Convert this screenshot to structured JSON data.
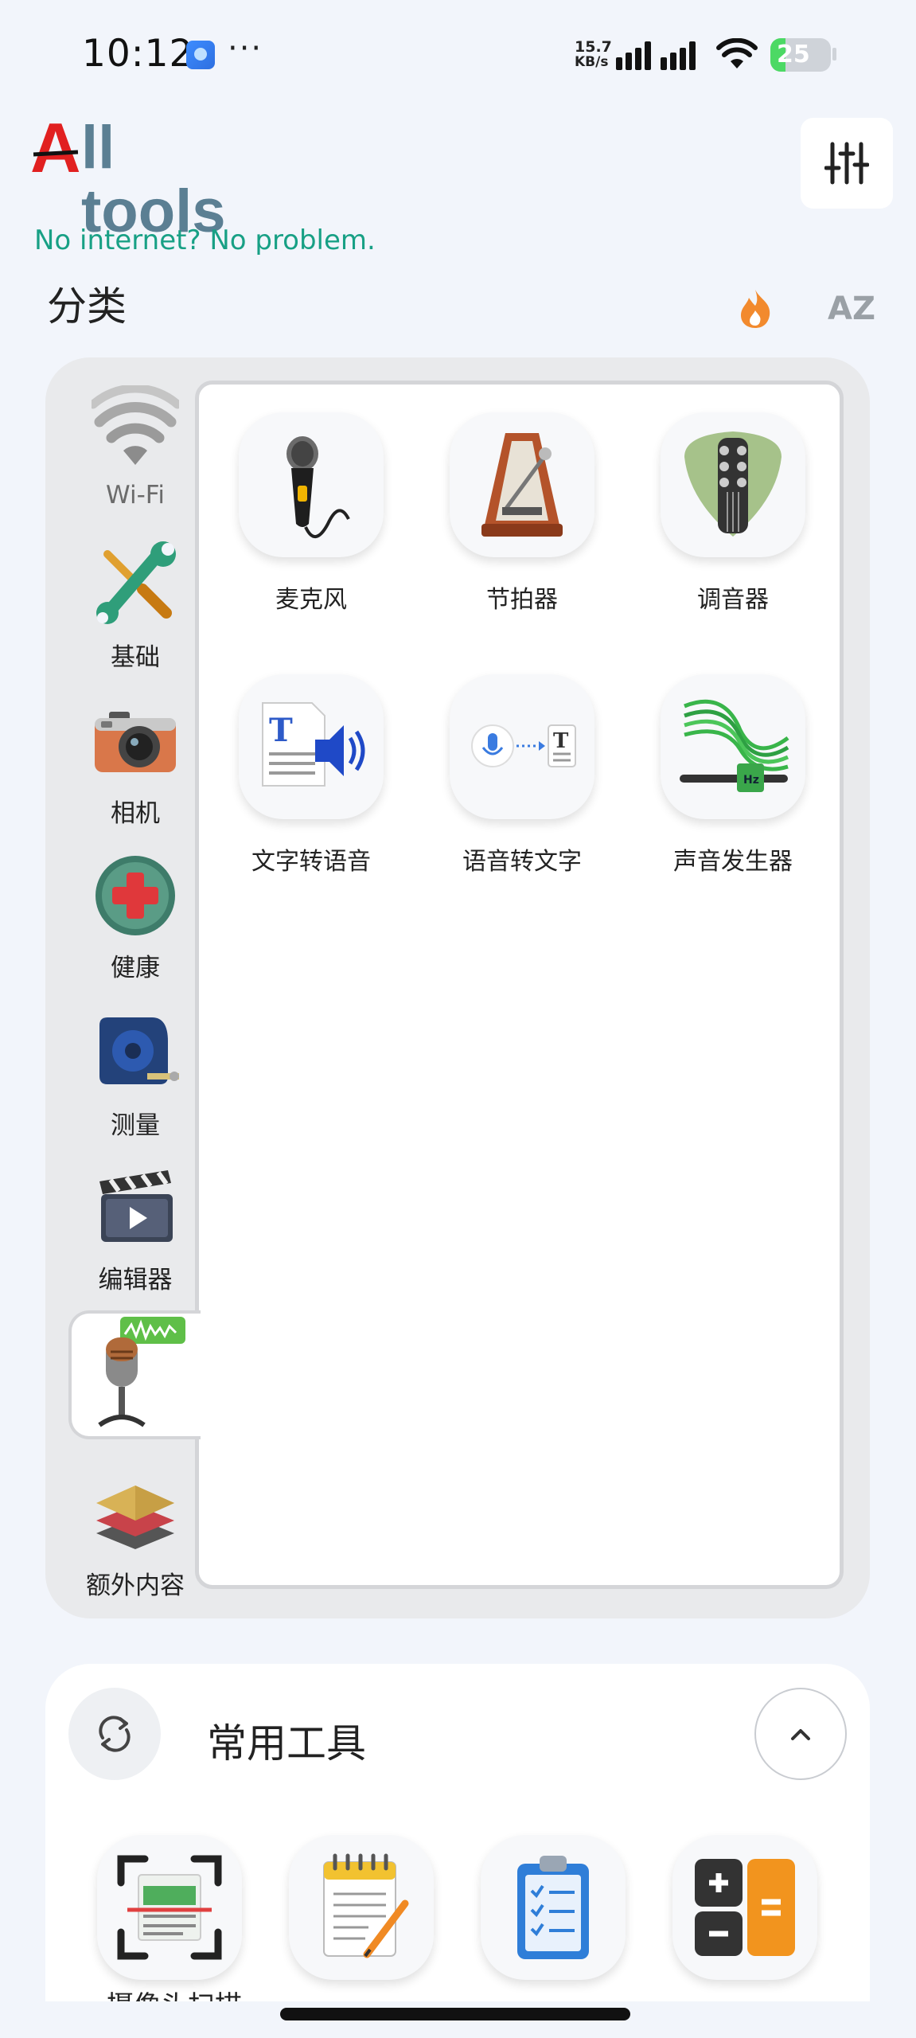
{
  "status_bar": {
    "time": "10:12",
    "more": "···",
    "speed_value": "15.7",
    "speed_unit": "KB/s",
    "battery": "25"
  },
  "header": {
    "logo_first": "A",
    "logo_rest": "ll tools",
    "tagline": "No internet? No problem.",
    "settings_icon": "sliders-icon"
  },
  "categories": {
    "title": "分类",
    "sort_popular_icon": "fire-icon",
    "sort_alpha": "AZ",
    "items": [
      {
        "label": "Wi-Fi",
        "icon": "wifi-icon"
      },
      {
        "label": "基础",
        "icon": "wrench-screwdriver-icon"
      },
      {
        "label": "相机",
        "icon": "camera-icon"
      },
      {
        "label": "健康",
        "icon": "health-cross-icon"
      },
      {
        "label": "测量",
        "icon": "tape-measure-icon"
      },
      {
        "label": "编辑器",
        "icon": "clapperboard-icon"
      },
      {
        "label": "",
        "icon": "studio-microphone-icon",
        "selected": true
      },
      {
        "label": "额外内容",
        "icon": "layers-icon"
      }
    ]
  },
  "tools": [
    {
      "label": "麦克风",
      "icon": "microphone-icon"
    },
    {
      "label": "节拍器",
      "icon": "metronome-icon"
    },
    {
      "label": "调音器",
      "icon": "guitar-tuner-icon"
    },
    {
      "label": "文字转语音",
      "icon": "text-to-speech-icon"
    },
    {
      "label": "语音转文字",
      "icon": "speech-to-text-icon"
    },
    {
      "label": "声音发生器",
      "icon": "sound-generator-icon"
    }
  ],
  "common_tools": {
    "title": "常用工具",
    "items": [
      {
        "label": "摄像头扫描",
        "icon": "document-scanner-icon"
      },
      {
        "label": "",
        "icon": "notepad-icon"
      },
      {
        "label": "",
        "icon": "checklist-icon"
      },
      {
        "label": "",
        "icon": "calculator-icon"
      }
    ]
  },
  "colors": {
    "accent_green": "#18a085",
    "logo_red": "#e12020",
    "logo_teal": "#5b7f93",
    "background": "#f2f5fb"
  }
}
